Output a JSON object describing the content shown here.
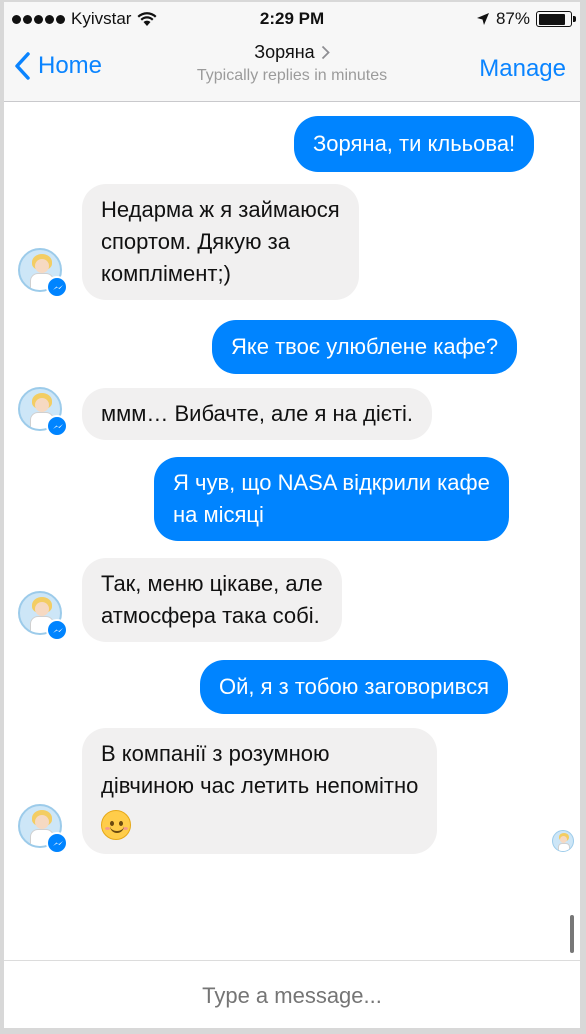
{
  "status_bar": {
    "carrier": "Kyivstar",
    "time": "2:29 PM",
    "battery_percent": "87%",
    "battery_level": 0.87
  },
  "nav": {
    "back_label": "Home",
    "title": "Зоряна",
    "subtitle": "Typically replies in minutes",
    "manage_label": "Manage"
  },
  "messages": [
    {
      "from": "me",
      "text": "Зоряна, ти клььова!"
    },
    {
      "from": "bot",
      "lines": [
        "Недарма ж я займаюся",
        "спортом. Дякую за",
        "комплімент;)"
      ]
    },
    {
      "from": "me",
      "text": "Яке твоє улюблене кафе?"
    },
    {
      "from": "bot",
      "lines": [
        "ммм… Вибачте, але я на дієті."
      ]
    },
    {
      "from": "me",
      "lines": [
        "Я чув, що NASA відкрили кафе",
        "на місяці"
      ]
    },
    {
      "from": "bot",
      "lines": [
        "Так, меню цікаве, але",
        "атмосфера така собі."
      ]
    },
    {
      "from": "me",
      "text": "Ой, я з тобою заговорився"
    },
    {
      "from": "bot",
      "lines": [
        "В компанії з розумною",
        "дівчиною час летить непомітно"
      ],
      "emoji": "smiling-face-emoji"
    }
  ],
  "composer": {
    "placeholder": "Type a message..."
  },
  "colors": {
    "accent": "#0084ff",
    "nav_link": "#0a84ff",
    "incoming_bubble": "#f1f0f0",
    "outgoing_bubble": "#0084ff"
  },
  "icons": [
    "wifi-icon",
    "location-arrow-icon",
    "battery-icon",
    "back-chevron-icon",
    "title-chevron-icon",
    "messenger-badge-icon",
    "smiling-face-emoji"
  ]
}
